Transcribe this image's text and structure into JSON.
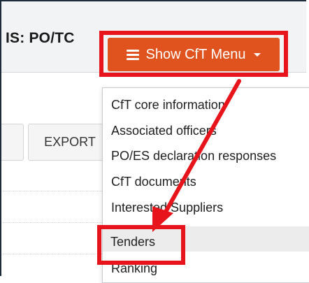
{
  "header": {
    "status_text": "IS: PO/TC"
  },
  "menu_button": {
    "label": "Show CfT Menu",
    "icon": "list-icon"
  },
  "toolbar": {
    "export_label": "EXPORT"
  },
  "dropdown": {
    "items": [
      {
        "label": "CfT core information"
      },
      {
        "label": "Associated officers"
      },
      {
        "label": "PO/ES declaration responses"
      },
      {
        "label": "CfT documents"
      },
      {
        "label": "Interested Suppliers"
      },
      {
        "label": "Tenders"
      },
      {
        "label": "Ranking"
      }
    ]
  },
  "colors": {
    "annotation_red": "#e8141b",
    "menu_button_bg": "#e0531f",
    "hover_bg": "#ececec"
  }
}
